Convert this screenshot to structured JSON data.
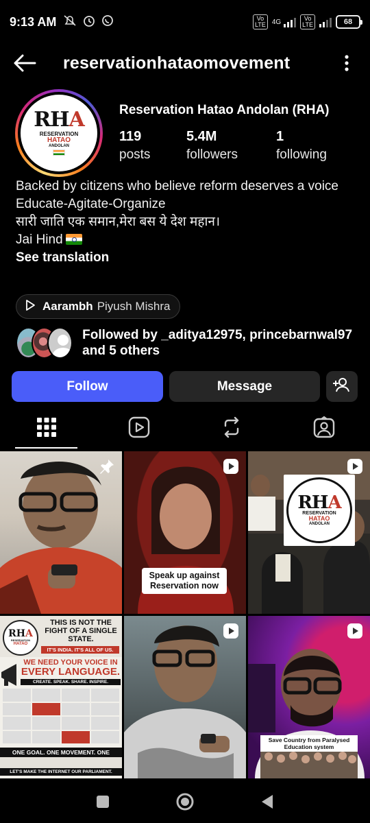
{
  "status_bar": {
    "time": "9:13 AM",
    "network_gen": "4G",
    "volte_label": "Vo\nLTE",
    "battery": "68"
  },
  "header": {
    "username": "reservationhataomovement",
    "back_icon": "back-arrow-icon",
    "more_icon": "more-vertical-icon"
  },
  "profile": {
    "display_name": "Reservation Hatao Andolan  (RHA)",
    "avatar_logo": {
      "rha": "RHA",
      "line1": "RESERVATION",
      "line2": "HATAO",
      "line3": "ANDOLAN"
    },
    "stats": [
      {
        "value": "119",
        "label": "posts"
      },
      {
        "value": "5.4M",
        "label": "followers"
      },
      {
        "value": "1",
        "label": "following"
      }
    ],
    "bio_lines": [
      "Backed by citizens who believe reform deserves a voice",
      "Educate-Agitate-Organize",
      "सारी जाति एक समान,मेरा बस ये देश महान।",
      "Jai Hind"
    ],
    "see_translation": "See translation",
    "music": {
      "title": "Aarambh",
      "artist": "Piyush Mishra"
    },
    "followed_by": "Followed by _aditya12975, princebarnwal97 and 5 others"
  },
  "actions": {
    "follow": "Follow",
    "message": "Message",
    "add_user_icon": "add-user-icon"
  },
  "tabs": [
    {
      "name": "grid",
      "icon": "grid-icon",
      "active": true
    },
    {
      "name": "reels",
      "icon": "reels-icon",
      "active": false
    },
    {
      "name": "reposts",
      "icon": "repost-icon",
      "active": false
    },
    {
      "name": "tagged",
      "icon": "tagged-icon",
      "active": false
    }
  ],
  "posts": [
    {
      "type": "pinned",
      "caption": ""
    },
    {
      "type": "reel",
      "caption": "Speak up against\nReservation now"
    },
    {
      "type": "reel",
      "caption": ""
    },
    {
      "type": "image",
      "caption": "THIS IS NOT THE FIGHT OF A SINGLE STATE.",
      "poster": {
        "heading": "WE NEED YOUR VOICE IN",
        "heading2": "EVERY LANGUAGE.",
        "sub": "CREATE. SPEAK. SHARE. INSPIRE.",
        "footer": "ONE GOAL. ONE MOVEMENT. ONE FUTURE.",
        "tag": "IT'S INDIA. IT'S ALL OF US.",
        "bottom": "LET'S MAKE THE INTERNET OUR PARLIAMENT."
      }
    },
    {
      "type": "reel",
      "caption": ""
    },
    {
      "type": "reel",
      "caption": "Save Country from Paralysed\nEducation system"
    }
  ],
  "colors": {
    "follow_button": "#4a5df9",
    "secondary_button": "#262626",
    "background": "#000000"
  }
}
